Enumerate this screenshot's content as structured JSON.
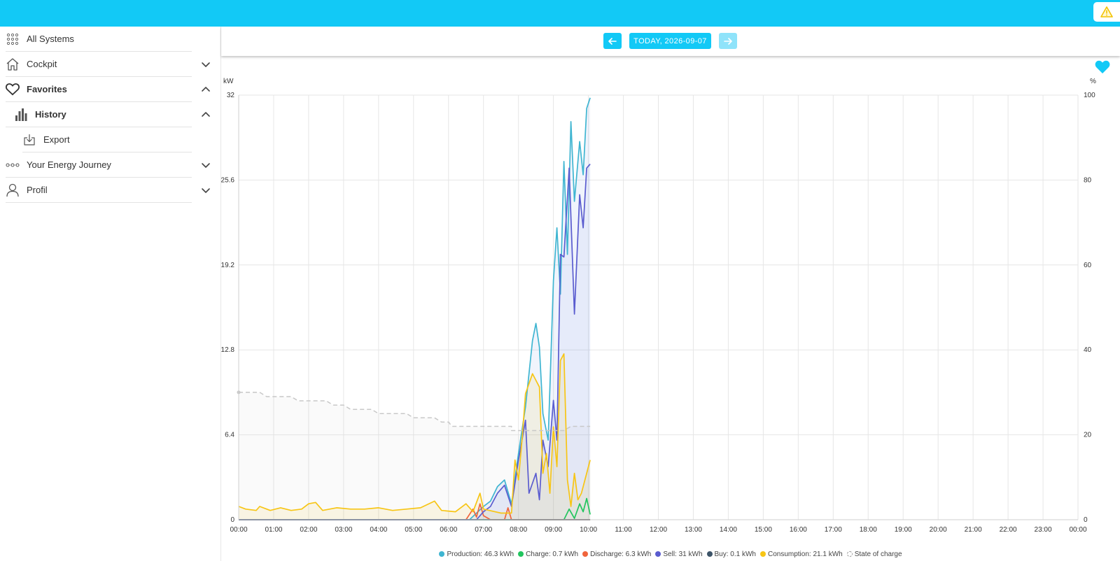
{
  "sidebar": {
    "items": [
      {
        "label": "All Systems",
        "icon": "grid-icon",
        "bold": false,
        "indent": 0,
        "chevron": "none"
      },
      {
        "label": "Cockpit",
        "icon": "home-icon",
        "bold": false,
        "indent": 0,
        "chevron": "down"
      },
      {
        "label": "Favorites",
        "icon": "heart-outline-icon",
        "bold": true,
        "indent": 0,
        "chevron": "up"
      },
      {
        "label": "History",
        "icon": "bar-chart-icon",
        "bold": true,
        "indent": 1,
        "chevron": "up"
      },
      {
        "label": "Export",
        "icon": "download-icon",
        "bold": false,
        "indent": 2,
        "chevron": "none"
      },
      {
        "label": "Your Energy Journey",
        "icon": "journey-icon",
        "bold": false,
        "indent": 0,
        "chevron": "down"
      },
      {
        "label": "Profil",
        "icon": "user-icon",
        "bold": false,
        "indent": 0,
        "chevron": "down"
      }
    ]
  },
  "header": {
    "date_label": "TODAY, 2026-09-07",
    "prev_icon": "arrow-left-icon",
    "next_icon": "arrow-right-icon"
  },
  "colors": {
    "topbar": "#12c9f6",
    "production": "#3fb5d1",
    "charge": "#22c55e",
    "discharge": "#f0643c",
    "sell": "#5a5ccf",
    "buy": "#3d5468",
    "consumption": "#f7c515",
    "soc": "#c8c8c8"
  },
  "chart_data": {
    "type": "line",
    "y_left_label": "kW",
    "y_right_label": "%",
    "ylim": [
      0,
      32
    ],
    "y2lim": [
      0,
      100
    ],
    "y_ticks": [
      "0",
      "6.4",
      "12.8",
      "19.2",
      "25.6",
      "32"
    ],
    "y2_ticks": [
      "0",
      "20",
      "40",
      "60",
      "80",
      "100"
    ],
    "x_ticks": [
      "00:00",
      "01:00",
      "02:00",
      "03:00",
      "04:00",
      "05:00",
      "06:00",
      "07:00",
      "08:00",
      "09:00",
      "10:00",
      "11:00",
      "12:00",
      "13:00",
      "14:00",
      "15:00",
      "16:00",
      "17:00",
      "18:00",
      "19:00",
      "20:00",
      "21:00",
      "22:00",
      "23:00",
      "00:00"
    ],
    "xlim_hours": [
      0,
      24
    ],
    "grid": true,
    "legend_position": "bottom",
    "series": [
      {
        "name": "Production: 46.3 kWh",
        "key": "production",
        "axis": "left",
        "points": [
          [
            0,
            0
          ],
          [
            6.6,
            0
          ],
          [
            6.8,
            0.5
          ],
          [
            7.0,
            1.0
          ],
          [
            7.2,
            1.4
          ],
          [
            7.4,
            2.5
          ],
          [
            7.6,
            3.0
          ],
          [
            7.8,
            1.2
          ],
          [
            8.0,
            5.0
          ],
          [
            8.2,
            8.5
          ],
          [
            8.4,
            13.5
          ],
          [
            8.5,
            14.8
          ],
          [
            8.6,
            13.0
          ],
          [
            8.7,
            8.0
          ],
          [
            8.85,
            6.0
          ],
          [
            9.0,
            18.0
          ],
          [
            9.1,
            22.0
          ],
          [
            9.2,
            17.0
          ],
          [
            9.3,
            27.0
          ],
          [
            9.4,
            20.0
          ],
          [
            9.5,
            30.0
          ],
          [
            9.6,
            24.0
          ],
          [
            9.75,
            28.5
          ],
          [
            9.85,
            26.0
          ],
          [
            9.95,
            31.0
          ],
          [
            10.05,
            31.8
          ]
        ]
      },
      {
        "name": "Charge: 0.7 kWh",
        "key": "charge",
        "axis": "left",
        "points": [
          [
            0,
            0
          ],
          [
            9.3,
            0
          ],
          [
            9.45,
            0.8
          ],
          [
            9.6,
            0.1
          ],
          [
            9.75,
            1.2
          ],
          [
            9.85,
            0.6
          ],
          [
            9.95,
            1.6
          ],
          [
            10.05,
            0.4
          ]
        ]
      },
      {
        "name": "Discharge: 6.3 kWh",
        "key": "discharge",
        "axis": "left",
        "points": [
          [
            0,
            0
          ],
          [
            6.5,
            0
          ],
          [
            6.7,
            0.8
          ],
          [
            6.8,
            0.2
          ],
          [
            6.9,
            1.2
          ],
          [
            7.0,
            0.3
          ],
          [
            7.2,
            0
          ],
          [
            7.6,
            0
          ],
          [
            7.7,
            0.9
          ],
          [
            7.8,
            0
          ],
          [
            10.05,
            0
          ]
        ]
      },
      {
        "name": "Sell: 31 kWh",
        "key": "sell",
        "axis": "left",
        "points": [
          [
            0,
            0
          ],
          [
            6.8,
            0
          ],
          [
            7.0,
            0.6
          ],
          [
            7.2,
            1.0
          ],
          [
            7.4,
            2.0
          ],
          [
            7.6,
            2.6
          ],
          [
            7.8,
            1.0
          ],
          [
            8.0,
            4.5
          ],
          [
            8.2,
            7.5
          ],
          [
            8.3,
            2.0
          ],
          [
            8.5,
            3.5
          ],
          [
            8.6,
            1.5
          ],
          [
            8.7,
            6.0
          ],
          [
            8.85,
            4.0
          ],
          [
            9.0,
            9.0
          ],
          [
            9.1,
            6.0
          ],
          [
            9.2,
            20.0
          ],
          [
            9.3,
            19.8
          ],
          [
            9.45,
            26.5
          ],
          [
            9.6,
            15.5
          ],
          [
            9.75,
            24.5
          ],
          [
            9.85,
            22.0
          ],
          [
            9.95,
            26.5
          ],
          [
            10.05,
            26.8
          ]
        ]
      },
      {
        "name": "Buy: 0.1 kWh",
        "key": "buy",
        "axis": "left",
        "points": [
          [
            0,
            0
          ],
          [
            10.05,
            0
          ]
        ]
      },
      {
        "name": "Consumption: 21.1 kWh",
        "key": "consumption",
        "axis": "left",
        "points": [
          [
            0,
            1.0
          ],
          [
            0.2,
            0.8
          ],
          [
            0.5,
            0.7
          ],
          [
            0.6,
            1.0
          ],
          [
            0.9,
            0.7
          ],
          [
            1.2,
            0.9
          ],
          [
            1.5,
            0.7
          ],
          [
            1.8,
            0.8
          ],
          [
            2.0,
            1.2
          ],
          [
            2.2,
            1.3
          ],
          [
            2.4,
            0.7
          ],
          [
            2.8,
            0.9
          ],
          [
            3.2,
            0.8
          ],
          [
            3.6,
            0.8
          ],
          [
            4.0,
            0.9
          ],
          [
            4.4,
            0.7
          ],
          [
            4.8,
            0.8
          ],
          [
            5.2,
            0.9
          ],
          [
            5.6,
            1.4
          ],
          [
            5.8,
            0.7
          ],
          [
            6.2,
            0.6
          ],
          [
            6.5,
            1.2
          ],
          [
            6.7,
            0.6
          ],
          [
            6.9,
            2.0
          ],
          [
            7.0,
            0.8
          ],
          [
            7.5,
            0.5
          ],
          [
            7.8,
            0.5
          ],
          [
            7.9,
            4.5
          ],
          [
            8.0,
            3.0
          ],
          [
            8.1,
            6.0
          ],
          [
            8.2,
            9.5
          ],
          [
            8.4,
            11.0
          ],
          [
            8.6,
            10.0
          ],
          [
            8.7,
            3.5
          ],
          [
            8.8,
            5.0
          ],
          [
            8.9,
            2.0
          ],
          [
            9.0,
            7.0
          ],
          [
            9.1,
            4.0
          ],
          [
            9.2,
            12.0
          ],
          [
            9.3,
            12.5
          ],
          [
            9.4,
            3.0
          ],
          [
            9.5,
            1.0
          ],
          [
            9.6,
            3.5
          ],
          [
            9.7,
            1.5
          ],
          [
            9.8,
            2.0
          ],
          [
            9.9,
            3.0
          ],
          [
            10.05,
            4.5
          ]
        ]
      },
      {
        "name": "State of charge",
        "key": "soc",
        "axis": "right",
        "dashed": true,
        "points": [
          [
            0,
            30
          ],
          [
            0.6,
            30
          ],
          [
            0.8,
            29
          ],
          [
            1.5,
            29
          ],
          [
            1.7,
            28
          ],
          [
            2.5,
            28
          ],
          [
            2.7,
            27
          ],
          [
            3.0,
            27
          ],
          [
            3.2,
            26
          ],
          [
            3.8,
            26
          ],
          [
            4.0,
            25
          ],
          [
            4.8,
            25
          ],
          [
            5.0,
            24
          ],
          [
            5.6,
            24
          ],
          [
            5.8,
            23
          ],
          [
            6.0,
            23
          ],
          [
            6.1,
            22
          ],
          [
            7.8,
            22
          ],
          [
            7.8,
            21
          ],
          [
            9.3,
            21
          ],
          [
            9.5,
            22
          ],
          [
            10.05,
            22
          ]
        ]
      }
    ]
  }
}
